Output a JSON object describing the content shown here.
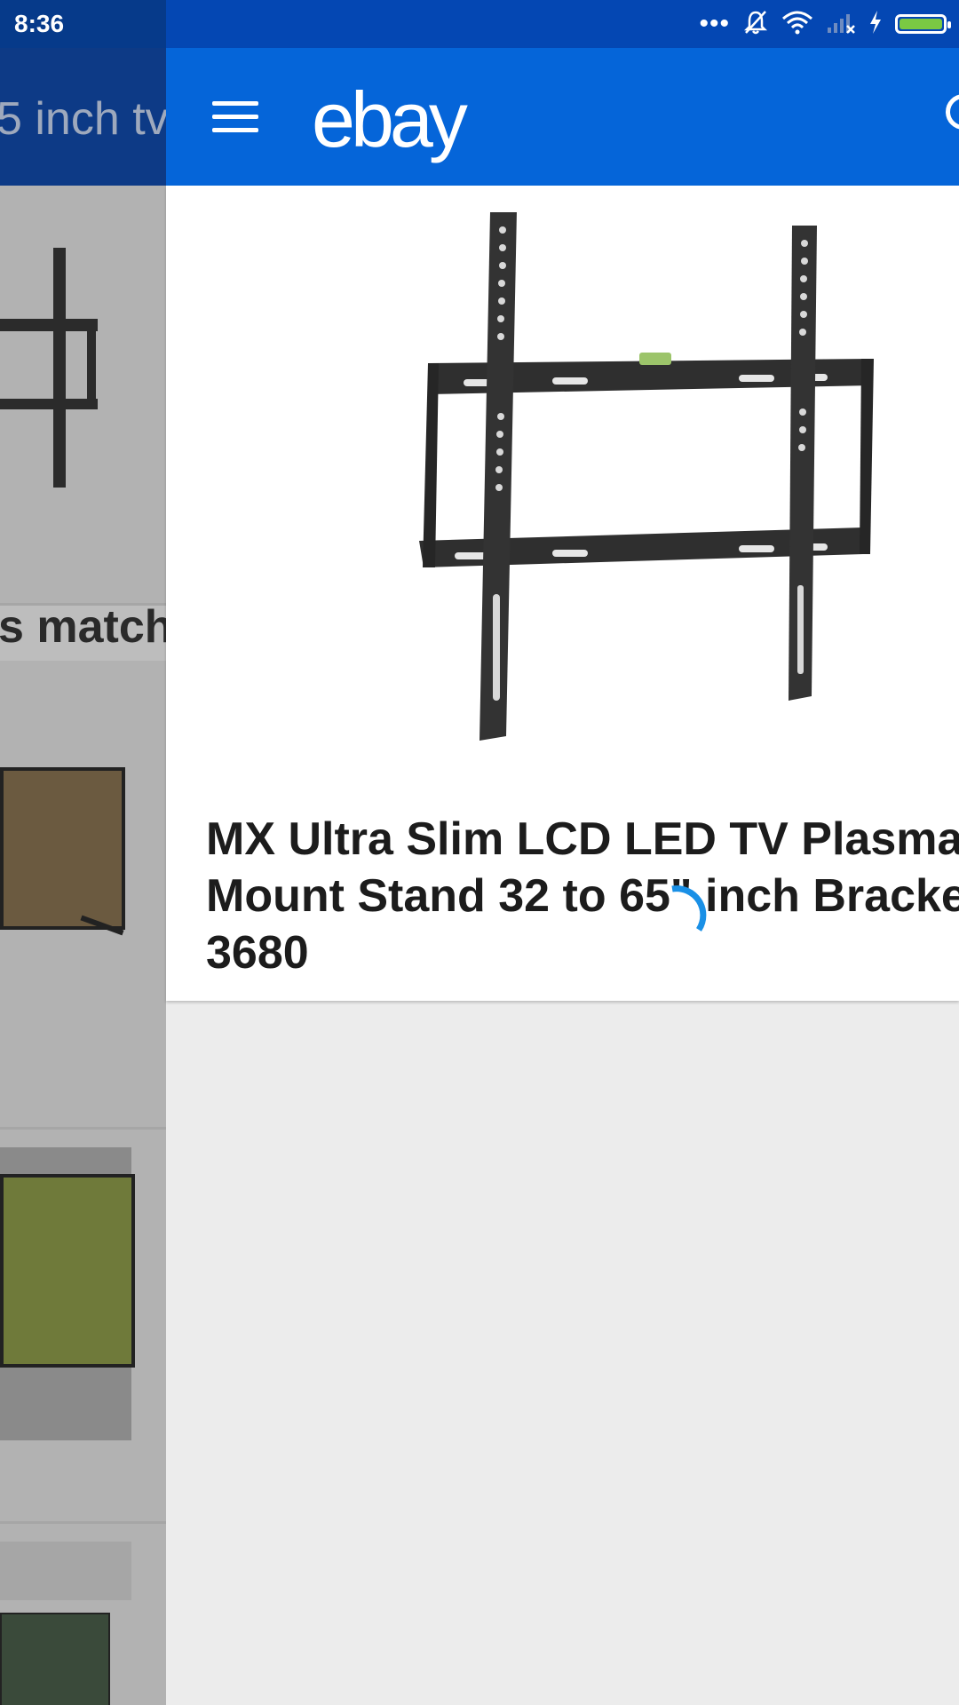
{
  "status_bar": {
    "time": "8:36",
    "icons": [
      "more-dots-icon",
      "bell-off-icon",
      "wifi-icon",
      "signal-off-icon",
      "charging-icon",
      "battery-icon"
    ]
  },
  "background_page": {
    "search_query_fragment": "5 inch tv",
    "heading_fragment": "s match"
  },
  "header": {
    "logo": "ebay",
    "menu_icon": "menu-icon",
    "search_icon": "search-icon",
    "color": "#0565d9"
  },
  "product": {
    "title": "MX Ultra Slim LCD LED TV Plasma Mount Stand 32 to 65\" inch Bracke 3680",
    "image": "tv-wall-mount-bracket"
  },
  "loading": {
    "spinner_color": "#1a90e6"
  }
}
